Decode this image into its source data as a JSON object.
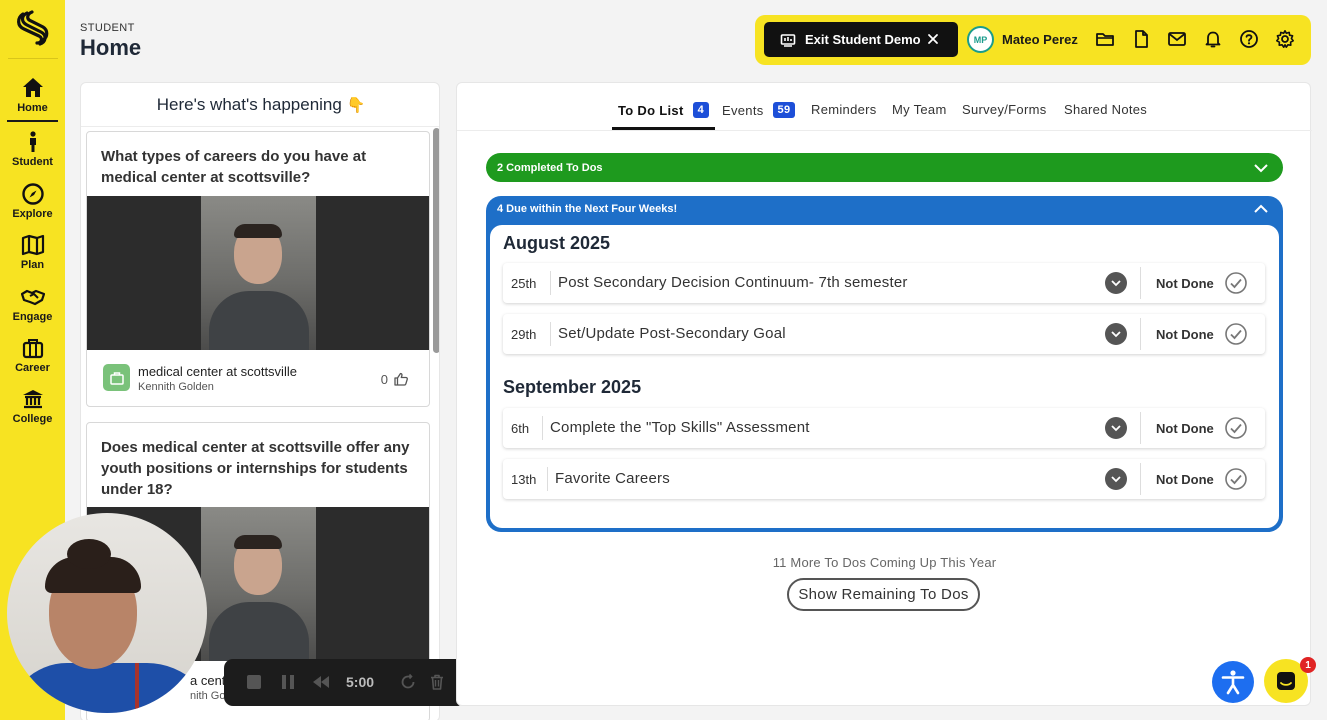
{
  "sidebar": {
    "items": [
      {
        "label": "Home",
        "icon": "home-icon"
      },
      {
        "label": "Student",
        "icon": "person-icon"
      },
      {
        "label": "Explore",
        "icon": "compass-icon"
      },
      {
        "label": "Plan",
        "icon": "map-icon"
      },
      {
        "label": "Engage",
        "icon": "handshake-icon"
      },
      {
        "label": "Career",
        "icon": "briefcase-icon"
      },
      {
        "label": "College",
        "icon": "college-icon"
      }
    ],
    "active": "Home"
  },
  "header": {
    "crumb": "STUDENT",
    "title": "Home"
  },
  "topbar": {
    "exit_label": "Exit Student Demo",
    "avatar_initials": "MP",
    "user_name": "Mateo Perez",
    "icons": [
      "folder-icon",
      "document-icon",
      "mail-icon",
      "bell-icon",
      "help-icon",
      "settings-icon"
    ]
  },
  "feed": {
    "title": "Here's what's happening",
    "title_emoji": "👇",
    "posts": [
      {
        "question": "What types of careers do you have at medical center at scottsville?",
        "org": "medical center at scottsville",
        "author": "Kennith Golden",
        "likes": "0"
      },
      {
        "question": "Does medical center at scottsville offer any youth positions or internships for students under 18?",
        "org": "medical center at scottsville",
        "author": "Kennith Golden"
      }
    ],
    "partial_org": "a center",
    "partial_author": "nith Golden"
  },
  "recorder": {
    "time": "5:00"
  },
  "tabs": [
    {
      "label": "To Do List",
      "badge": "4",
      "active": true
    },
    {
      "label": "Events",
      "badge": "59"
    },
    {
      "label": "Reminders"
    },
    {
      "label": "My Team"
    },
    {
      "label": "Survey/Forms"
    },
    {
      "label": "Shared Notes"
    }
  ],
  "completed_band": "2 Completed To Dos",
  "due_band": "4 Due within the Next Four Weeks!",
  "months": [
    {
      "name": "August 2025",
      "todos": [
        {
          "day": "25th",
          "title": "Post Secondary Decision Continuum- 7th semester",
          "status": "Not Done"
        },
        {
          "day": "29th",
          "title": "Set/Update Post-Secondary Goal",
          "status": "Not Done"
        }
      ]
    },
    {
      "name": "September 2025",
      "todos": [
        {
          "day": "6th",
          "title": "Complete the \"Top Skills\" Assessment",
          "status": "Not Done"
        },
        {
          "day": "13th",
          "title": "Favorite Careers",
          "status": "Not Done"
        }
      ]
    }
  ],
  "more_text": "11 More To Dos Coming Up This Year",
  "show_button": "Show Remaining To Dos",
  "chat_badge": "1",
  "colors": {
    "brand_yellow": "#f7e322",
    "completed_green": "#1e9a1e",
    "due_blue": "#1e6fc8",
    "badge_blue": "#1d4fd8"
  }
}
